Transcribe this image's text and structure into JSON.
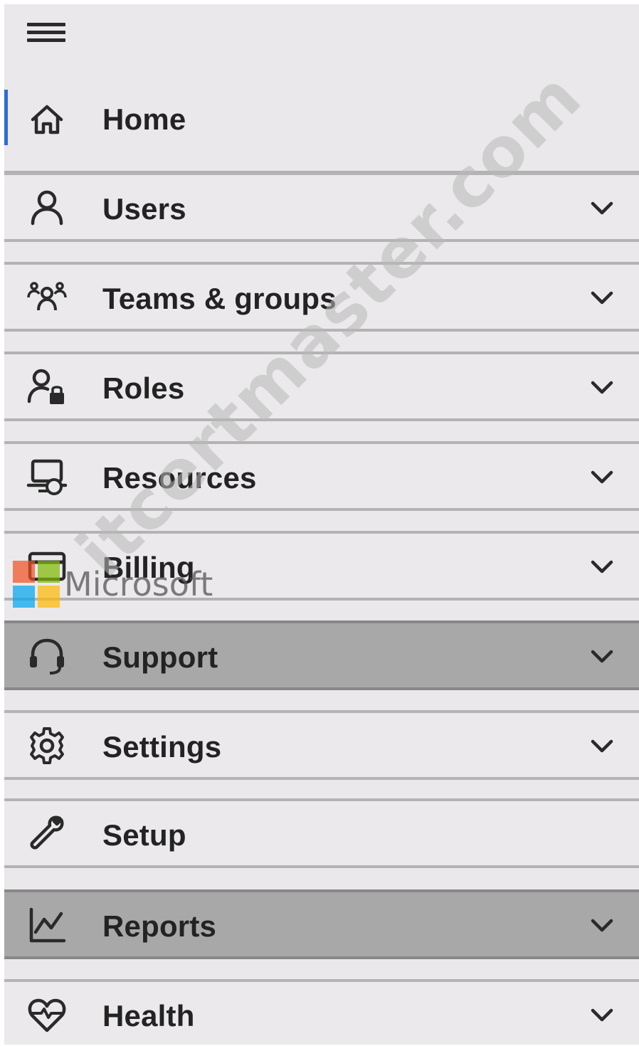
{
  "nav": {
    "menu_icon": "hamburger-icon",
    "items": [
      {
        "label": "Home",
        "icon": "home-icon",
        "expandable": false,
        "active": true
      },
      {
        "label": "Users",
        "icon": "user-icon",
        "expandable": true
      },
      {
        "label": "Teams & groups",
        "icon": "teams-icon",
        "expandable": true
      },
      {
        "label": "Roles",
        "icon": "roles-icon",
        "expandable": true
      },
      {
        "label": "Resources",
        "icon": "resources-icon",
        "expandable": true
      },
      {
        "label": "Billing",
        "icon": "billing-icon",
        "expandable": true
      },
      {
        "label": "Support",
        "icon": "headset-icon",
        "expandable": true,
        "highlighted": true
      },
      {
        "label": "Settings",
        "icon": "gear-icon",
        "expandable": true
      },
      {
        "label": "Setup",
        "icon": "wrench-icon",
        "expandable": false
      },
      {
        "label": "Reports",
        "icon": "chart-icon",
        "expandable": true,
        "highlighted": true
      },
      {
        "label": "Health",
        "icon": "heart-icon",
        "expandable": true
      }
    ]
  },
  "overlay": {
    "ms_logo_text": "Microsoft",
    "watermark": "itcertmaster.com"
  },
  "colors": {
    "accent": "#2f6bd8",
    "nav_bg": "#ebe8eb",
    "highlight": "#a8a8a8"
  }
}
